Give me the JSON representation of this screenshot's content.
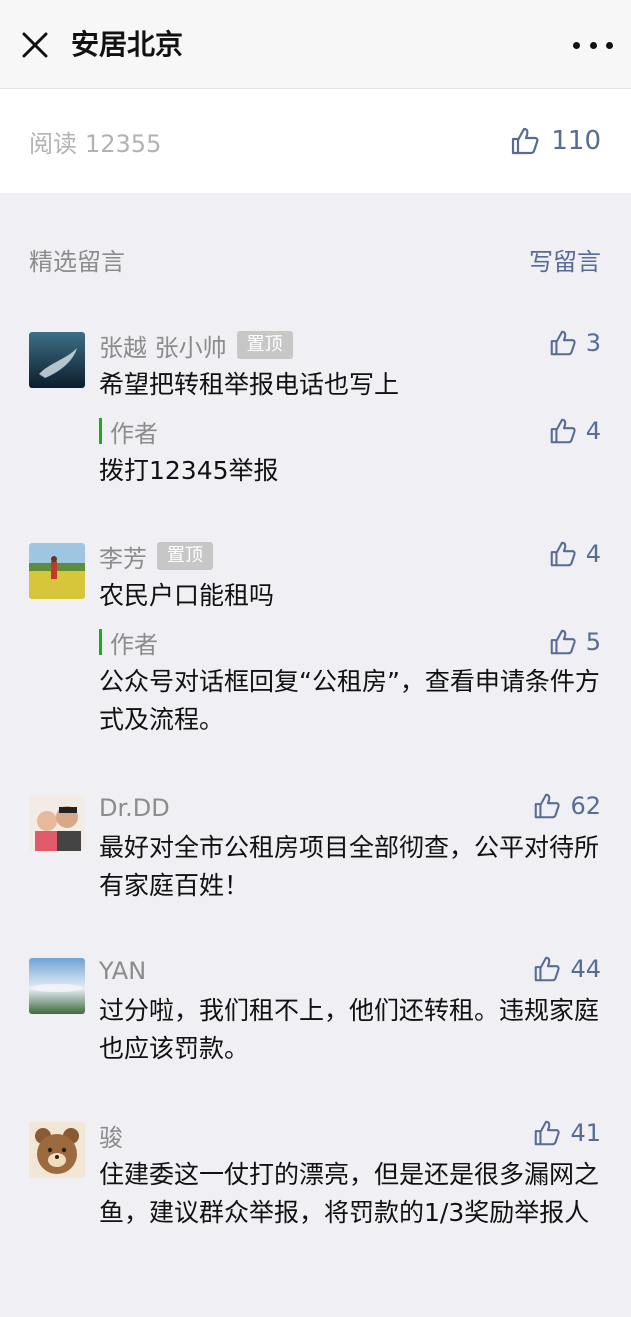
{
  "header": {
    "title": "安居北京"
  },
  "stats": {
    "read_label": "阅读",
    "read_count": "12355",
    "like_count": "110"
  },
  "section": {
    "title": "精选留言",
    "write_label": "写留言"
  },
  "comments": [
    {
      "name": "张越 张小帅",
      "badge": "置顶",
      "likes": "3",
      "text": "希望把转租举报电话也写上",
      "reply": {
        "label": "作者",
        "likes": "4",
        "text": "拨打12345举报"
      }
    },
    {
      "name": "李芳",
      "badge": "置顶",
      "likes": "4",
      "text": "农民户口能租吗",
      "reply": {
        "label": "作者",
        "likes": "5",
        "text": "公众号对话框回复“公租房”，查看申请条件方式及流程。"
      }
    },
    {
      "name": "Dr.DD",
      "likes": "62",
      "text": "最好对全市公租房项目全部彻查，公平对待所有家庭百姓！"
    },
    {
      "name": "YAN",
      "likes": "44",
      "text": "过分啦，我们租不上，他们还转租。违规家庭也应该罚款。"
    },
    {
      "name": "骏",
      "likes": "41",
      "text": "住建委这一仗打的漂亮，但是还是很多漏网之鱼，建议群众举报，将罚款的1/3奖励举报人"
    }
  ],
  "icons": {
    "close": "close-icon",
    "more": "more-icon",
    "like": "thumbs-up-icon"
  },
  "colors": {
    "link": "#576b95",
    "author_bar": "#1aad19",
    "badge": "#c7c7c7"
  }
}
